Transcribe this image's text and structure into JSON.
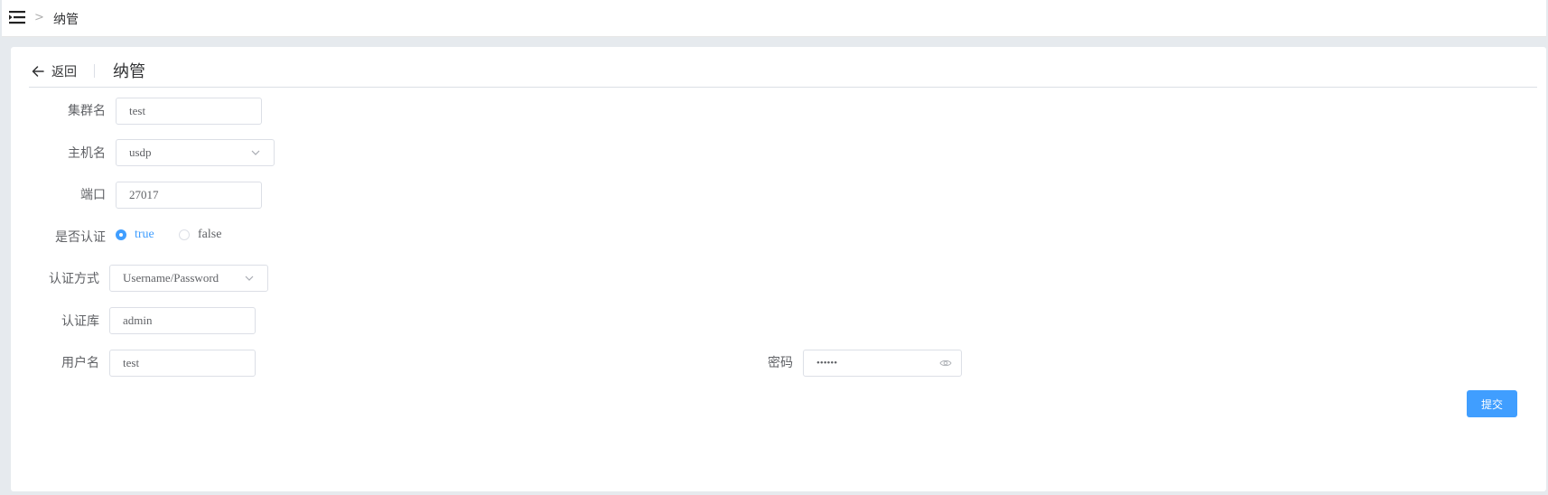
{
  "breadcrumb": {
    "separator": ">",
    "current": "纳管"
  },
  "header": {
    "back_label": "返回",
    "title": "纳管"
  },
  "form": {
    "cluster_name": {
      "label": "集群名",
      "value": "test"
    },
    "host_name": {
      "label": "主机名",
      "value": "usdp"
    },
    "port": {
      "label": "端口",
      "value": "27017"
    },
    "auth_enabled": {
      "label": "是否认证",
      "options": [
        "true",
        "false"
      ],
      "selected": "true"
    },
    "auth_method": {
      "label": "认证方式",
      "value": "Username/Password"
    },
    "auth_db": {
      "label": "认证库",
      "value": "admin"
    },
    "username": {
      "label": "用户名",
      "value": "test"
    },
    "password": {
      "label": "密码",
      "value": "••••••"
    },
    "submit_label": "提交"
  },
  "colors": {
    "primary": "#409eff",
    "border": "#dcdfe6",
    "background": "#e6eaee"
  },
  "icons": [
    "menu-icon",
    "arrow-left-icon",
    "chevron-down-icon",
    "eye-icon"
  ]
}
